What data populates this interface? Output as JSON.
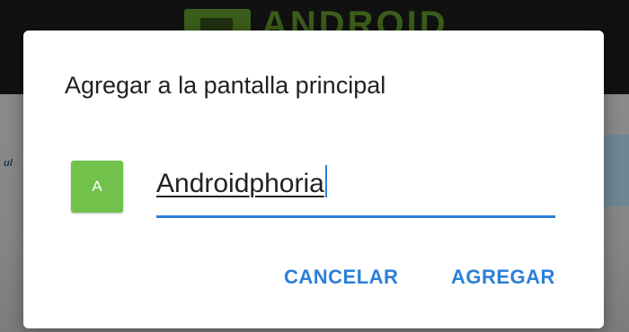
{
  "background": {
    "logo_text": "ANDROID",
    "edge_text": "ul"
  },
  "dialog": {
    "title": "Agregar a la pantalla principal",
    "app_icon_letter": "A",
    "name_input_value": "Androidphoria",
    "cancel_label": "CANCELAR",
    "add_label": "AGREGAR"
  },
  "colors": {
    "accent": "#2b7fd9",
    "icon_background": "#71c14a",
    "dialog_background": "#ffffff"
  }
}
